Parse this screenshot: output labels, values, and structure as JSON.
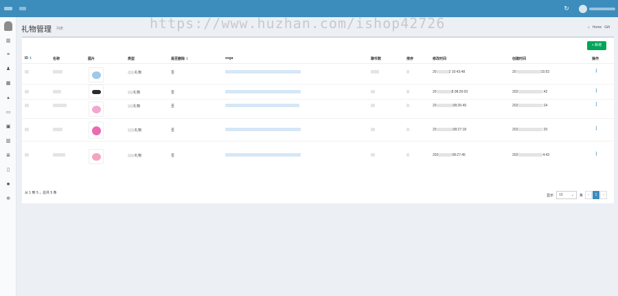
{
  "topbar": {
    "refresh_icon": "refresh-icon",
    "colors": {
      "brand": "#3c8dbc"
    }
  },
  "sidebar": {
    "icons": [
      "dashboard-chart-icon",
      "list-icon",
      "users-icon",
      "table-icon",
      "tree-icon",
      "card-icon",
      "image-icon",
      "bar-chart-icon",
      "menu-icon",
      "file-icon",
      "video-icon",
      "settings-icon"
    ]
  },
  "header": {
    "title": "礼物管理",
    "subtitle": "列表",
    "breadcrumb_home": "Home",
    "breadcrumb_current": "Gift"
  },
  "watermark": "https://www.huzhan.com/ishop42726",
  "toolbar": {
    "add_label": "+ 新增",
    "add_color": "#00a65a"
  },
  "table": {
    "columns": [
      "ID",
      "名称",
      "图片",
      "类型",
      "是否删除",
      "svga",
      "聊币数",
      "排序",
      "修改时间",
      "创建时间",
      "操作"
    ],
    "sortable_icon": "⇕",
    "rows": [
      {
        "type_prefix": "",
        "type_suffix": "礼物",
        "deleted": "否",
        "coins": "",
        "mtime_a": "20",
        "mtime_b": "2 10:43:48",
        "ctime_a": "20",
        "ctime_b": "15:53",
        "img_color": "#9ec9e8",
        "op": "⋮"
      },
      {
        "type_prefix": "",
        "type_suffix": "礼物",
        "deleted": "否",
        "coins": "",
        "mtime_a": "20",
        "mtime_b": "8 08:26:03",
        "ctime_a": "202",
        "ctime_b": ":42",
        "img_color": "#2b2b2b",
        "op": "⋮"
      },
      {
        "type_prefix": "",
        "type_suffix": "礼物",
        "deleted": "否",
        "coins": "",
        "mtime_a": "20",
        "mtime_b": "08:26:49",
        "ctime_a": "202",
        "ctime_b": ":24",
        "img_color": "#f2a7cf",
        "op": "⋮"
      },
      {
        "type_prefix": "",
        "type_suffix": "礼物",
        "deleted": "否",
        "coins": "",
        "mtime_a": "20",
        "mtime_b": "08:27:18",
        "ctime_a": "202",
        "ctime_b": ":20",
        "img_color": "#e96bb0",
        "op": "⋮"
      },
      {
        "type_prefix": "",
        "type_suffix": "礼物",
        "deleted": "否",
        "coins": "",
        "mtime_a": "202",
        "mtime_b": "08:27:45",
        "ctime_a": "202",
        "ctime_b": "4:43",
        "img_color": "#f6a3c1",
        "op": "⋮"
      }
    ],
    "row_names": [
      "",
      "",
      "",
      "",
      ""
    ]
  },
  "footer": {
    "info": "从 1 到 5 ，总共 5 条",
    "show_label": "显示",
    "page_size": "10",
    "per_label": "条",
    "prev": "‹",
    "current_page": "1",
    "next": "›"
  }
}
